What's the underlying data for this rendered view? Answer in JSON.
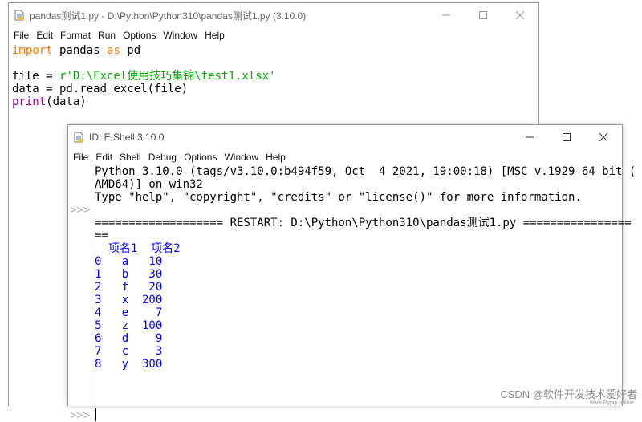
{
  "editor": {
    "title": "pandas测试1.py - D:\\Python\\Python310\\pandas测试1.py (3.10.0)",
    "menu": [
      "File",
      "Edit",
      "Format",
      "Run",
      "Options",
      "Window",
      "Help"
    ],
    "code": {
      "l1_kw1": "import",
      "l1_mid": " pandas ",
      "l1_kw2": "as",
      "l1_end": " pd",
      "l3_start": "file = ",
      "l3_str": "r'D:\\Excel使用技巧集锦\\test1.xlsx'",
      "l4": "data = pd.read_excel(file)",
      "l5_bi": "print",
      "l5_end": "(data)"
    }
  },
  "shell": {
    "title": "IDLE Shell 3.10.0",
    "menu": [
      "File",
      "Edit",
      "Shell",
      "Debug",
      "Options",
      "Window",
      "Help"
    ],
    "prompt": ">>>",
    "banner1": "Python 3.10.0 (tags/v3.10.0:b494f59, Oct  4 2021, 19:00:18) [MSC v.1929 64 bit (",
    "banner2": "AMD64)] on win32",
    "banner3": "Type \"help\", \"copyright\", \"credits\" or \"license()\" for more information.",
    "restart1": "=================== RESTART: D:\\Python\\Python310\\pandas测试1.py ================",
    "restart2": "==",
    "table": {
      "header": "  项名1  项名2",
      "rows": [
        "0   a   10",
        "1   b   30",
        "2   f   20",
        "3   x  200",
        "4   e    7",
        "5   z  100",
        "6   d    9",
        "7   c    3",
        "8   y  300"
      ]
    }
  },
  "watermark": "CSDN @软件开发技术爱好者",
  "watermark_url": "www.Pypip.online"
}
